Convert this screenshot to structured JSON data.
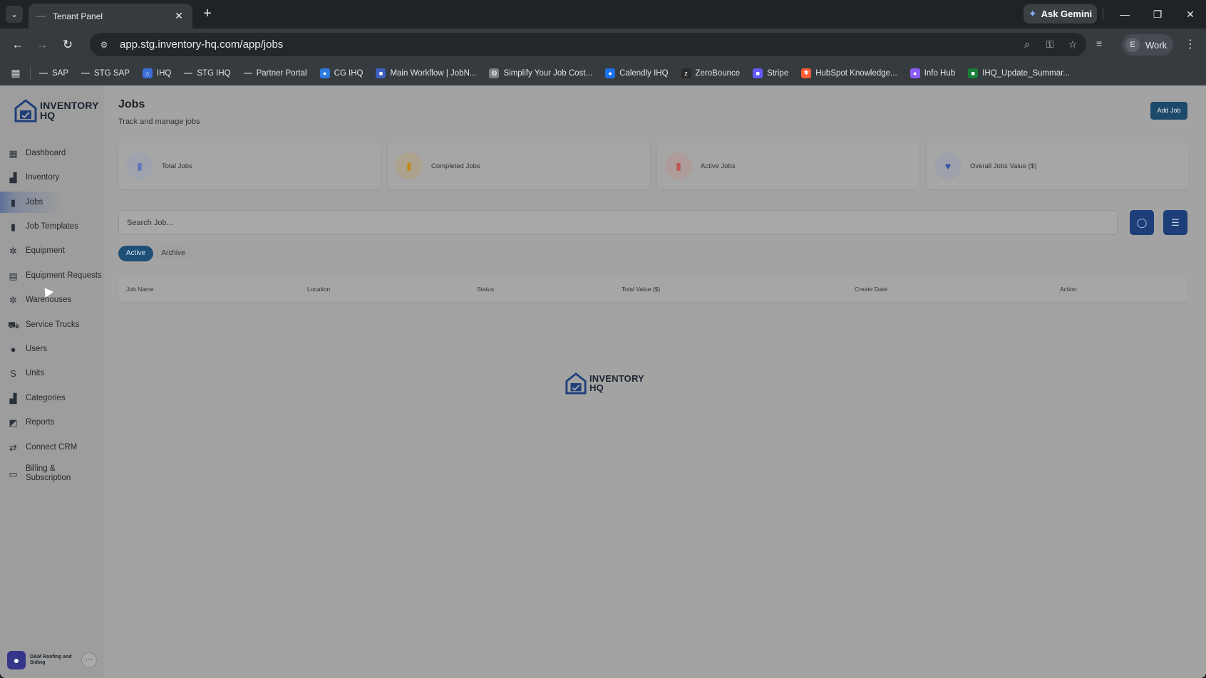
{
  "browser": {
    "tab_title": "Tenant Panel",
    "url": "app.stg.inventory-hq.com/app/jobs",
    "gemini_label": "Ask Gemini",
    "profile_initial": "E",
    "profile_label": "Work",
    "bookmarks": [
      {
        "label": "SAP",
        "icon": "dash",
        "color": "#8d9297"
      },
      {
        "label": "STG SAP",
        "icon": "dash",
        "color": "#8d9297"
      },
      {
        "label": "IHQ",
        "icon": "house",
        "color": "#3b6fd6"
      },
      {
        "label": "STG IHQ",
        "icon": "dash",
        "color": "#8d9297"
      },
      {
        "label": "Partner Portal",
        "icon": "dash",
        "color": "#8d9297"
      },
      {
        "label": "CG IHQ",
        "icon": "circle",
        "color": "#2d7be0"
      },
      {
        "label": "Main Workflow | JobN...",
        "icon": "square",
        "color": "#3b5fc0"
      },
      {
        "label": "Simplify Your Job Cost...",
        "icon": "globe",
        "color": "#7d8185"
      },
      {
        "label": "Calendly IHQ",
        "icon": "circle",
        "color": "#1a73e8"
      },
      {
        "label": "ZeroBounce",
        "icon": "zb",
        "color": "#2b2b2b"
      },
      {
        "label": "Stripe",
        "icon": "square",
        "color": "#635bff"
      },
      {
        "label": "HubSpot Knowledge...",
        "icon": "hub",
        "color": "#ff5c35"
      },
      {
        "label": "Info Hub",
        "icon": "circle",
        "color": "#8c5cf6"
      },
      {
        "label": "IHQ_Update_Summar...",
        "icon": "square",
        "color": "#188038"
      }
    ]
  },
  "app": {
    "logo_line1": "INVENTORY",
    "logo_line2": "HQ",
    "nav": [
      {
        "label": "Dashboard",
        "icon": "▦",
        "name": "dashboard"
      },
      {
        "label": "Inventory",
        "icon": "▟",
        "name": "inventory"
      },
      {
        "label": "Jobs",
        "icon": "▮",
        "name": "jobs",
        "active": true
      },
      {
        "label": "Job Templates",
        "icon": "▮",
        "name": "job-templates"
      },
      {
        "label": "Equipment",
        "icon": "✲",
        "name": "equipment"
      },
      {
        "label": "Equipment Requests",
        "icon": "▤",
        "name": "equipment-requests"
      },
      {
        "label": "Warehouses",
        "icon": "✲",
        "name": "warehouses"
      },
      {
        "label": "Service Trucks",
        "icon": "⛟",
        "name": "service-trucks"
      },
      {
        "label": "Users",
        "icon": "●",
        "name": "users"
      },
      {
        "label": "Units",
        "icon": "S",
        "name": "units"
      },
      {
        "label": "Categories",
        "icon": "▟",
        "name": "categories"
      },
      {
        "label": "Reports",
        "icon": "◩",
        "name": "reports"
      },
      {
        "label": "Connect CRM",
        "icon": "⇄",
        "name": "connect-crm"
      },
      {
        "label": "Billing & Subscription",
        "icon": "▭",
        "name": "billing-subscription"
      }
    ],
    "company_name": "D&M Roofing and Siding",
    "more_label": "···"
  },
  "page": {
    "title": "Jobs",
    "subtitle": "Track and manage jobs",
    "add_button": "Add Job",
    "stats": [
      {
        "label": "Total Jobs",
        "icon": "▮",
        "icon_color": "#5b77b8",
        "bg": "#9ea3ad"
      },
      {
        "label": "Completed Jobs",
        "icon": "▮",
        "icon_color": "#c28a1b",
        "bg": "#aca28e"
      },
      {
        "label": "Active Jobs",
        "icon": "▮",
        "icon_color": "#c2564c",
        "bg": "#ad9c9a"
      },
      {
        "label": "Overall Jobs Value ($)",
        "icon": "♥",
        "icon_color": "#3351a8",
        "bg": "#9ea1ab"
      }
    ],
    "search_placeholder": "Search Job...",
    "tabs": {
      "active": "Active",
      "archive": "Archive"
    },
    "table_columns": [
      "Job Name",
      "Location",
      "Status",
      "Total Value ($)",
      "Create Date",
      "Action"
    ]
  }
}
